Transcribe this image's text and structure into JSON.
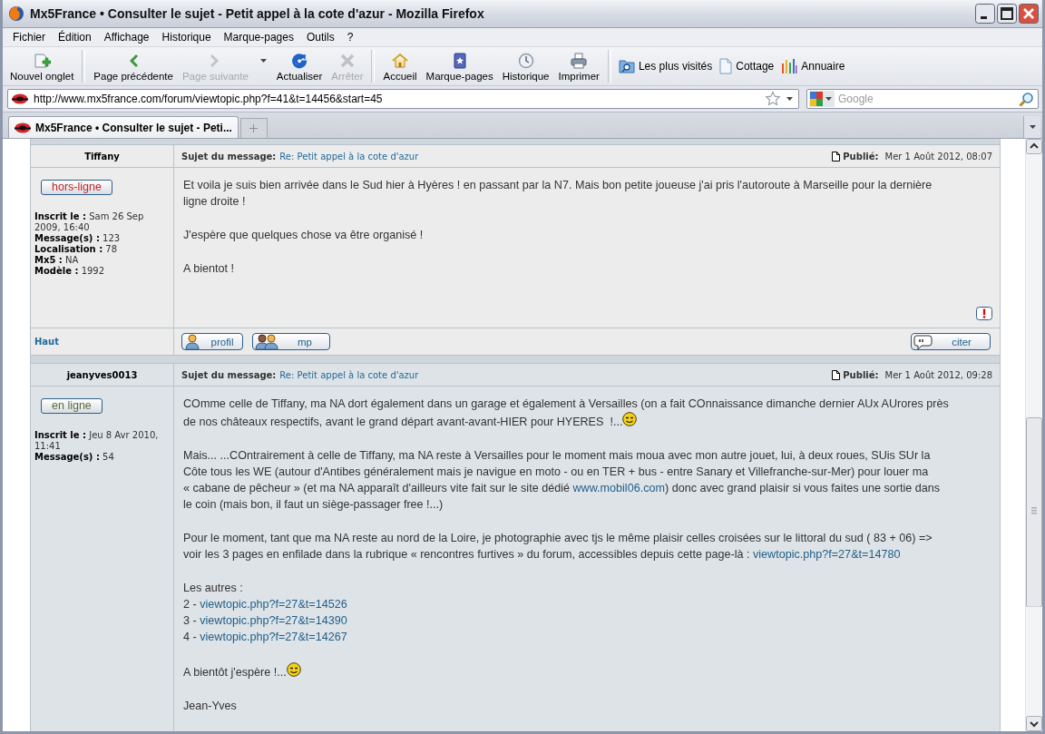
{
  "window": {
    "title": "Mx5France • Consulter le sujet - Petit appel à la cote d'azur - Mozilla Firefox"
  },
  "menu": [
    "Fichier",
    "Édition",
    "Affichage",
    "Historique",
    "Marque-pages",
    "Outils",
    "?"
  ],
  "toolbar": [
    {
      "kind": "newtab",
      "label": "Nouvel onglet",
      "disabled": false
    },
    {
      "kind": "separator"
    },
    {
      "kind": "back",
      "label": "Page précédente",
      "disabled": false
    },
    {
      "kind": "forward",
      "label": "Page suivante",
      "disabled": true
    },
    {
      "kind": "dropdown"
    },
    {
      "kind": "reload",
      "label": "Actualiser",
      "disabled": false
    },
    {
      "kind": "stop",
      "label": "Arrêter",
      "disabled": true
    },
    {
      "kind": "separator"
    },
    {
      "kind": "home",
      "label": "Accueil",
      "disabled": false
    },
    {
      "kind": "bookmarks",
      "label": "Marque-pages",
      "disabled": false
    },
    {
      "kind": "history",
      "label": "Historique",
      "disabled": false
    },
    {
      "kind": "print",
      "label": "Imprimer",
      "disabled": false
    },
    {
      "kind": "separator"
    }
  ],
  "bookmarks_bar": [
    {
      "kind": "folder",
      "label": "Les plus visités"
    },
    {
      "kind": "page",
      "label": "Cottage"
    },
    {
      "kind": "bars",
      "label": "Annuaire"
    }
  ],
  "address_bar": {
    "value": "http://www.mx5france.com/forum/viewtopic.php?f=41&t=14456&start=45"
  },
  "search": {
    "placeholder": "Google"
  },
  "tabs": [
    {
      "label": "Mx5France • Consulter le sujet - Peti...",
      "selected": true
    }
  ],
  "posts": [
    {
      "author": "Tiffany",
      "status": {
        "label": "hors-ligne",
        "online": false
      },
      "profile": [
        {
          "label": "Inscrit le :",
          "value": "Sam 26 Sep 2009, 16:40"
        },
        {
          "label": "Message(s) :",
          "value": "123"
        },
        {
          "label": "Localisation :",
          "value": "78"
        },
        {
          "label": "Mx5 :",
          "value": "NA"
        },
        {
          "label": "Modèle :",
          "value": "1992"
        }
      ],
      "subject_label": "Sujet du message:",
      "subject": "Re: Petit appel à la cote d'azur",
      "published_label": "Publié:",
      "date": "Mer 1 Août 2012, 08:07",
      "paragraphs": [
        {
          "lines": [
            [
              {
                "kind": "text",
                "text": "Et voila je suis bien arrivée dans le Sud hier à Hyères ! en passant par la N7. Mais bon petite joueuse j'ai pris l'autoroute à Marseille pour la dernière"
              }
            ],
            [
              {
                "kind": "text",
                "text": "ligne droite !"
              }
            ]
          ]
        },
        {
          "lines": [
            [
              {
                "kind": "text",
                "text": "J'espère que quelques chose va être organisé !"
              }
            ]
          ]
        },
        {
          "lines": [
            [
              {
                "kind": "text",
                "text": "A bientot !"
              }
            ]
          ]
        }
      ],
      "report_button": true,
      "footer": {
        "top_link": "Haut",
        "buttons": [
          {
            "kind": "profile",
            "label": "profil"
          },
          {
            "kind": "pm",
            "label": "mp"
          },
          {
            "kind": "quote",
            "label": "citer"
          }
        ]
      }
    },
    {
      "author": "jeanyves0013",
      "status": {
        "label": "en ligne",
        "online": true
      },
      "profile": [
        {
          "label": "Inscrit le :",
          "value": "Jeu 8 Avr 2010, 11:41"
        },
        {
          "label": "Message(s) :",
          "value": "54"
        }
      ],
      "subject_label": "Sujet du message:",
      "subject": "Re: Petit appel à la cote d'azur",
      "published_label": "Publié:",
      "date": "Mer 1 Août 2012, 09:28",
      "paragraphs": [
        {
          "lines": [
            [
              {
                "kind": "text",
                "text": "COmme celle de Tiffany, ma NA dort également dans un garage et également à Versailles (on a fait COnnaissance dimanche dernier AUx AUrores près"
              }
            ],
            [
              {
                "kind": "text",
                "text": "de nos châteaux respectifs, avant le grand départ avant-avant-HIER pour HYERES  !..."
              },
              {
                "kind": "smiley"
              }
            ]
          ]
        },
        {
          "lines": [
            [
              {
                "kind": "text",
                "text": "Mais... ...COntrairement à celle de Tiffany, ma NA reste à Versailles pour le moment mais moua avec mon autre jouet, lui, à deux roues, SUis SUr la"
              }
            ],
            [
              {
                "kind": "text",
                "text": "Côte tous les WE (autour d'Antibes généralement mais je navigue en moto - ou en TER + bus - entre Sanary et Villefranche-sur-Mer) pour louer ma"
              }
            ],
            [
              {
                "kind": "text",
                "text": "« cabane de pêcheur » (et ma NA apparaît d'ailleurs vite fait sur le site dédié "
              },
              {
                "kind": "link",
                "text": "www.mobil06.com"
              },
              {
                "kind": "text",
                "text": ") donc avec grand plaisir si vous faites une sortie dans"
              }
            ],
            [
              {
                "kind": "text",
                "text": "le coin (mais bon, il faut un siège-passager free !...)"
              }
            ]
          ]
        },
        {
          "lines": [
            [
              {
                "kind": "text",
                "text": "Pour le moment, tant que ma NA reste au nord de la Loire, je photographie avec tjs le même plaisir celles croisées sur le littoral du sud ( 83 + 06) =>"
              }
            ],
            [
              {
                "kind": "text",
                "text": "voir les 3 pages en enfilade dans la rubrique « rencontres furtives » du forum, accessibles depuis cette page-là : "
              },
              {
                "kind": "link",
                "text": "viewtopic.php?f=27&t=14780"
              }
            ]
          ]
        },
        {
          "lines": [
            [
              {
                "kind": "text",
                "text": "Les autres :"
              }
            ],
            [
              {
                "kind": "text",
                "text": "2 - "
              },
              {
                "kind": "link",
                "text": "viewtopic.php?f=27&t=14526"
              }
            ],
            [
              {
                "kind": "text",
                "text": "3 - "
              },
              {
                "kind": "link",
                "text": "viewtopic.php?f=27&t=14390"
              }
            ],
            [
              {
                "kind": "text",
                "text": "4 - "
              },
              {
                "kind": "link",
                "text": "viewtopic.php?f=27&t=14267"
              }
            ]
          ]
        },
        {
          "lines": [
            [
              {
                "kind": "text",
                "text": "A bientôt j'espère !..."
              },
              {
                "kind": "smiley"
              }
            ]
          ]
        },
        {
          "lines": [
            [
              {
                "kind": "text",
                "text": "Jean-Yves"
              }
            ]
          ]
        }
      ]
    }
  ]
}
